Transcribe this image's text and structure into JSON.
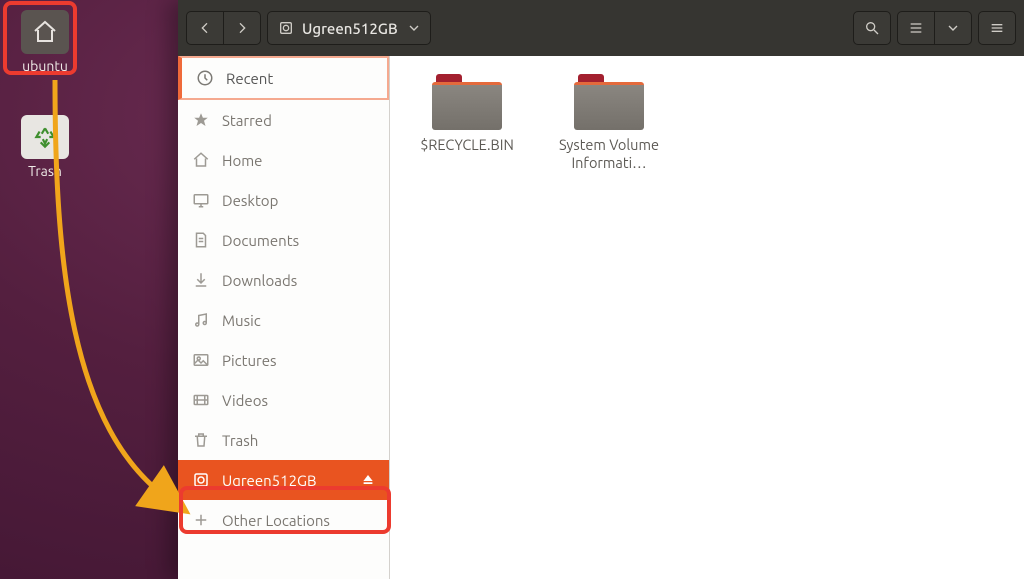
{
  "desktop": {
    "home_label": "ubuntu",
    "trash_label": "Trash"
  },
  "window": {
    "breadcrumb": "Ugreen512GB"
  },
  "sidebar": {
    "items": [
      {
        "label": "Recent"
      },
      {
        "label": "Starred"
      },
      {
        "label": "Home"
      },
      {
        "label": "Desktop"
      },
      {
        "label": "Documents"
      },
      {
        "label": "Downloads"
      },
      {
        "label": "Music"
      },
      {
        "label": "Pictures"
      },
      {
        "label": "Videos"
      },
      {
        "label": "Trash"
      },
      {
        "label": "Ugreen512GB"
      },
      {
        "label": "Other Locations"
      }
    ]
  },
  "files": {
    "items": [
      {
        "name": "$RECYCLE.BIN"
      },
      {
        "name": "System Volume Informati…"
      }
    ]
  }
}
